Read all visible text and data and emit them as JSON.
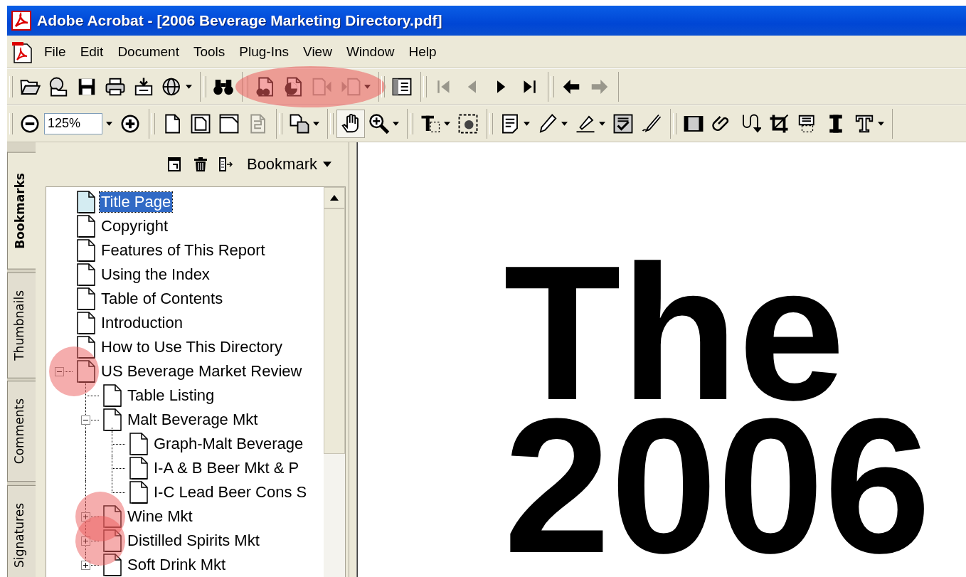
{
  "window": {
    "title": "Adobe Acrobat - [2006 Beverage Marketing Directory.pdf]"
  },
  "menu": [
    "File",
    "Edit",
    "Document",
    "Tools",
    "Plug-Ins",
    "View",
    "Window",
    "Help"
  ],
  "toolbars": [
    {
      "groups": [
        {
          "highlighted": false,
          "buttons": [
            {
              "kind": "button",
              "disabled": false,
              "dropdown": false
            },
            {
              "kind": "button",
              "disabled": false,
              "dropdown": false
            },
            {
              "kind": "button",
              "disabled": false,
              "dropdown": false
            },
            {
              "kind": "button",
              "disabled": false,
              "dropdown": false
            },
            {
              "kind": "button",
              "disabled": false,
              "dropdown": false
            },
            {
              "kind": "button",
              "disabled": false,
              "dropdown": true
            }
          ]
        },
        {
          "highlighted": false,
          "buttons": [
            {
              "kind": "button",
              "disabled": false,
              "dropdown": false
            }
          ]
        },
        {
          "highlighted": true,
          "buttons": [
            {
              "kind": "button",
              "disabled": false,
              "dropdown": false
            },
            {
              "kind": "button",
              "disabled": false,
              "dropdown": false
            },
            {
              "kind": "button",
              "disabled": true,
              "dropdown": false
            },
            {
              "kind": "button",
              "disabled": true,
              "dropdown": true
            }
          ]
        },
        {
          "highlighted": false,
          "buttons": [
            {
              "kind": "button",
              "disabled": false,
              "dropdown": false
            }
          ]
        },
        {
          "highlighted": false,
          "buttons": [
            {
              "kind": "button",
              "disabled": true,
              "dropdown": false
            },
            {
              "kind": "button",
              "disabled": true,
              "dropdown": false
            },
            {
              "kind": "button",
              "disabled": false,
              "dropdown": false
            },
            {
              "kind": "button",
              "disabled": false,
              "dropdown": false
            }
          ]
        },
        {
          "highlighted": false,
          "buttons": [
            {
              "kind": "button",
              "disabled": false,
              "dropdown": false
            },
            {
              "kind": "button",
              "disabled": true,
              "dropdown": false
            }
          ]
        }
      ]
    },
    {
      "groups": [
        {
          "highlighted": false,
          "buttons": [
            {
              "kind": "button",
              "disabled": false,
              "dropdown": false,
              "selected": false
            },
            {
              "kind": "field",
              "value": "125%"
            },
            {
              "kind": "button",
              "disabled": false,
              "dropdown": false,
              "selected": false
            }
          ]
        },
        {
          "highlighted": false,
          "buttons": [
            {
              "kind": "button",
              "disabled": false,
              "dropdown": false,
              "selected": false
            },
            {
              "kind": "button",
              "disabled": false,
              "dropdown": false,
              "selected": false
            },
            {
              "kind": "button",
              "disabled": false,
              "dropdown": false,
              "selected": false
            },
            {
              "kind": "button",
              "disabled": true,
              "dropdown": false,
              "selected": false
            }
          ]
        },
        {
          "highlighted": false,
          "buttons": [
            {
              "kind": "button",
              "disabled": false,
              "dropdown": true,
              "selected": false
            }
          ]
        },
        {
          "highlighted": false,
          "buttons": [
            {
              "kind": "button",
              "disabled": false,
              "dropdown": false,
              "selected": true
            },
            {
              "kind": "button",
              "disabled": false,
              "dropdown": true,
              "selected": false
            }
          ]
        },
        {
          "highlighted": false,
          "buttons": [
            {
              "kind": "button",
              "disabled": false,
              "dropdown": true,
              "selected": false
            },
            {
              "kind": "button",
              "disabled": false,
              "dropdown": false,
              "selected": false
            }
          ]
        },
        {
          "highlighted": false,
          "buttons": [
            {
              "kind": "button",
              "disabled": false,
              "dropdown": true,
              "selected": false
            },
            {
              "kind": "button",
              "disabled": false,
              "dropdown": true,
              "selected": false
            },
            {
              "kind": "button",
              "disabled": false,
              "dropdown": true,
              "selected": false
            },
            {
              "kind": "button",
              "disabled": false,
              "dropdown": false,
              "selected": false
            },
            {
              "kind": "button",
              "disabled": false,
              "dropdown": false,
              "selected": false
            }
          ]
        },
        {
          "highlighted": false,
          "buttons": [
            {
              "kind": "button",
              "disabled": false,
              "dropdown": false,
              "selected": false
            },
            {
              "kind": "button",
              "disabled": false,
              "dropdown": false,
              "selected": false
            },
            {
              "kind": "button",
              "disabled": false,
              "dropdown": false,
              "selected": false
            },
            {
              "kind": "button",
              "disabled": false,
              "dropdown": false,
              "selected": false
            },
            {
              "kind": "button",
              "disabled": false,
              "dropdown": false,
              "selected": false
            },
            {
              "kind": "button",
              "disabled": false,
              "dropdown": false,
              "selected": false
            },
            {
              "kind": "button",
              "disabled": false,
              "dropdown": true,
              "selected": false
            }
          ]
        }
      ]
    }
  ],
  "side_tabs": [
    {
      "label": "Bookmarks",
      "selected": true
    },
    {
      "label": "Thumbnails",
      "selected": false
    },
    {
      "label": "Comments",
      "selected": false
    },
    {
      "label": "Signatures",
      "selected": false
    }
  ],
  "bookmarks_panel": {
    "options_button": "Bookmark"
  },
  "tree": {
    "items": [
      {
        "label": "Title Page",
        "selected": true,
        "highlighted": false
      },
      {
        "label": "Copyright",
        "selected": false,
        "highlighted": false
      },
      {
        "label": "Features of This Report",
        "selected": false,
        "highlighted": false
      },
      {
        "label": "Using the Index",
        "selected": false,
        "highlighted": false
      },
      {
        "label": "Table of Contents",
        "selected": false,
        "highlighted": false
      },
      {
        "label": "Introduction",
        "selected": false,
        "highlighted": false
      },
      {
        "label": "How to Use This Directory",
        "selected": false,
        "highlighted": false
      },
      {
        "label": "US Beverage Market Review",
        "selected": false,
        "highlighted": true,
        "expanded": true,
        "children": [
          {
            "label": "Table Listing",
            "selected": false,
            "highlighted": false
          },
          {
            "label": "Malt Beverage Mkt",
            "selected": false,
            "highlighted": false,
            "expanded": true,
            "children": [
              {
                "label": "Graph-Malt Beverage",
                "selected": false,
                "highlighted": false
              },
              {
                "label": "I-A & B Beer Mkt & P",
                "selected": false,
                "highlighted": false
              },
              {
                "label": "I-C Lead Beer Cons S",
                "selected": false,
                "highlighted": false
              }
            ]
          },
          {
            "label": "Wine Mkt",
            "selected": false,
            "highlighted": true,
            "expanded": false
          },
          {
            "label": "Distilled Spirits Mkt",
            "selected": false,
            "highlighted": true,
            "expanded": false
          },
          {
            "label": "Soft Drink Mkt",
            "selected": false,
            "highlighted": false,
            "expanded": false
          }
        ]
      }
    ]
  },
  "document": {
    "heading_lines": [
      "The",
      "2006"
    ]
  }
}
